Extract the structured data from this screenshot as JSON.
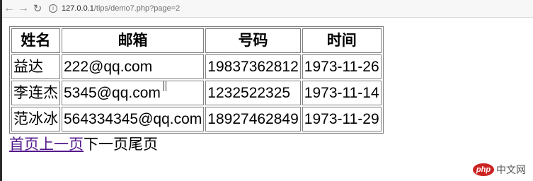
{
  "browser": {
    "url_host": "127.0.0.1",
    "url_path": "/tips/demo7.php?page=2",
    "back_icon": "arrow-left",
    "forward_icon": "arrow-right",
    "reload_icon": "reload",
    "info_icon": "info-circle"
  },
  "table": {
    "headers": [
      "姓名",
      "邮箱",
      "号码",
      "时间"
    ],
    "rows": [
      [
        "益达",
        "222@qq.com",
        "19837362812",
        "1973-11-26"
      ],
      [
        "李连杰",
        "5345@qq.com",
        "1232522325",
        "1973-11-14"
      ],
      [
        "范冰冰",
        "564334345@qq.com",
        "18927462849",
        "1973-11-29"
      ]
    ]
  },
  "pager": {
    "first": "首页",
    "prev": "上一页",
    "next": "下一页",
    "last": "尾页"
  },
  "watermark": {
    "logo_text": "php",
    "site_text": "中文网"
  }
}
